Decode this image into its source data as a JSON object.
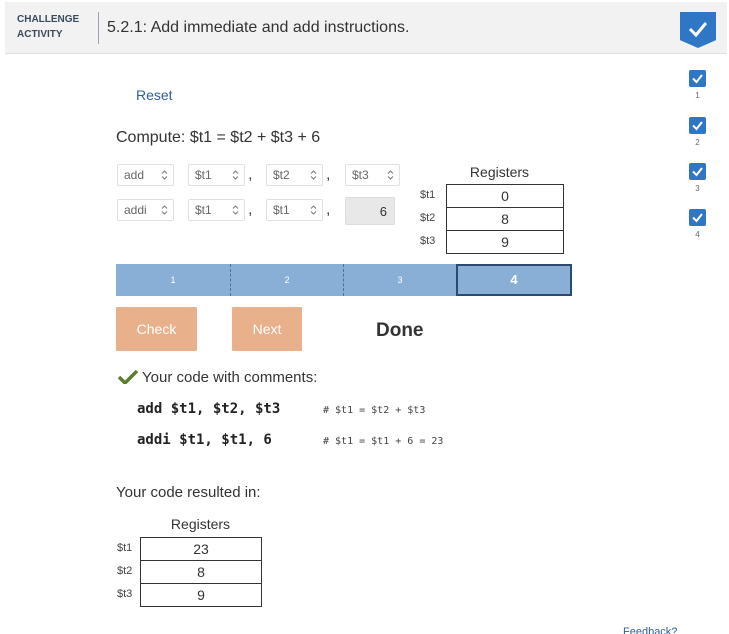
{
  "header": {
    "badge_line1": "CHALLENGE",
    "badge_line2": "ACTIVITY",
    "title": "5.2.1: Add immediate and add instructions."
  },
  "levels": [
    {
      "num": "1",
      "status": "complete"
    },
    {
      "num": "2",
      "status": "complete"
    },
    {
      "num": "3",
      "status": "complete"
    },
    {
      "num": "4",
      "status": "complete"
    }
  ],
  "reset_label": "Reset",
  "prompt": "Compute: $t1 = $t2 + $t3 + 6",
  "instructions": [
    {
      "op": "add",
      "rd": "$t1",
      "rs": "$t2",
      "rt": "$t3"
    },
    {
      "op": "addi",
      "rd": "$t1",
      "rs": "$t1",
      "imm": "6"
    }
  ],
  "comma": ",",
  "registers_top": {
    "title": "Registers",
    "rows": [
      {
        "name": "$t1",
        "value": "0"
      },
      {
        "name": "$t2",
        "value": "8"
      },
      {
        "name": "$t3",
        "value": "9"
      }
    ]
  },
  "progress": {
    "steps": [
      "1",
      "2",
      "3",
      "4"
    ],
    "current": "4"
  },
  "buttons": {
    "check": "Check",
    "next": "Next"
  },
  "done_label": "Done",
  "result_heading": "Your code with comments:",
  "code_lines": [
    {
      "code": "add $t1, $t2, $t3",
      "comment": "# $t1 = $t2 + $t3"
    },
    {
      "code": "addi $t1, $t1, 6",
      "comment": "# $t1 = $t1 + 6 = 23"
    }
  ],
  "resulted_heading": "Your code resulted in:",
  "registers_result": {
    "title": "Registers",
    "rows": [
      {
        "name": "$t1",
        "value": "23"
      },
      {
        "name": "$t2",
        "value": "8"
      },
      {
        "name": "$t3",
        "value": "9"
      }
    ]
  },
  "footer_link": "Feedback?",
  "colors": {
    "accent": "#2f76c5",
    "progress": "#89afd6",
    "button": "#e8b08b",
    "check_green": "#5a7e2e"
  }
}
